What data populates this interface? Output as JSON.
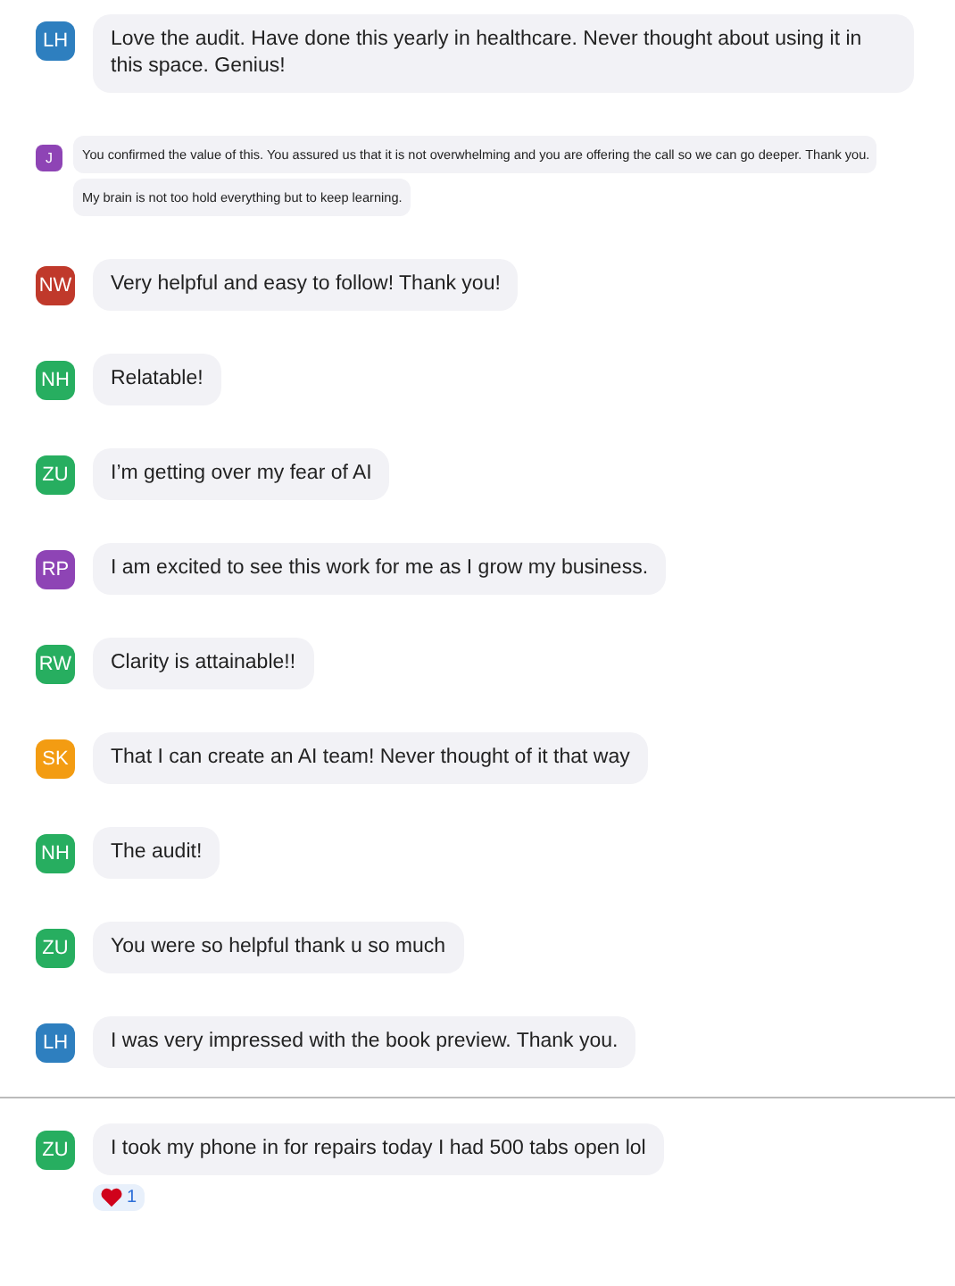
{
  "messages": [
    {
      "initials": "LH",
      "color": "#2e7fbf",
      "kind": "normal",
      "bubbles": [
        "Love the audit. Have done this yearly in healthcare. Never thought about using it in this space. Genius!"
      ]
    },
    {
      "initials": "J",
      "color": "#8e44b5",
      "kind": "compact",
      "bubbles": [
        "You confirmed the value of this. You assured us that it is not overwhelming and you are offering the call so we can go deeper.  Thank you.",
        "My brain is not too hold everything but to keep learning."
      ]
    },
    {
      "initials": "NW",
      "color": "#c0392b",
      "kind": "normal",
      "bubbles": [
        "Very helpful and easy to follow!  Thank you!"
      ]
    },
    {
      "initials": "NH",
      "color": "#27ae60",
      "kind": "normal",
      "bubbles": [
        "Relatable!"
      ]
    },
    {
      "initials": "ZU",
      "color": "#27ae60",
      "kind": "normal",
      "bubbles": [
        "I’m getting over my fear of AI"
      ]
    },
    {
      "initials": "RP",
      "color": "#8e44b5",
      "kind": "normal",
      "bubbles": [
        "I am excited to see this work for me as I grow my business."
      ]
    },
    {
      "initials": "RW",
      "color": "#27ae60",
      "kind": "normal",
      "bubbles": [
        "Clarity is attainable!!"
      ]
    },
    {
      "initials": "SK",
      "color": "#f39c12",
      "kind": "normal",
      "bubbles": [
        "That I can create an AI team! Never thought of it that way"
      ]
    },
    {
      "initials": "NH",
      "color": "#27ae60",
      "kind": "normal",
      "bubbles": [
        "The audit!"
      ]
    },
    {
      "initials": "ZU",
      "color": "#27ae60",
      "kind": "normal",
      "bubbles": [
        "You were so helpful thank u so much"
      ]
    },
    {
      "initials": "LH",
      "color": "#2e7fbf",
      "kind": "normal",
      "bubbles": [
        "I was very impressed with the book preview. Thank you."
      ]
    },
    {
      "initials": "ZU",
      "color": "#27ae60",
      "kind": "normal",
      "divider_before": true,
      "bubbles": [
        "I took my phone in for repairs today I had 500 tabs open lol"
      ],
      "reaction": {
        "count": "1"
      }
    }
  ]
}
